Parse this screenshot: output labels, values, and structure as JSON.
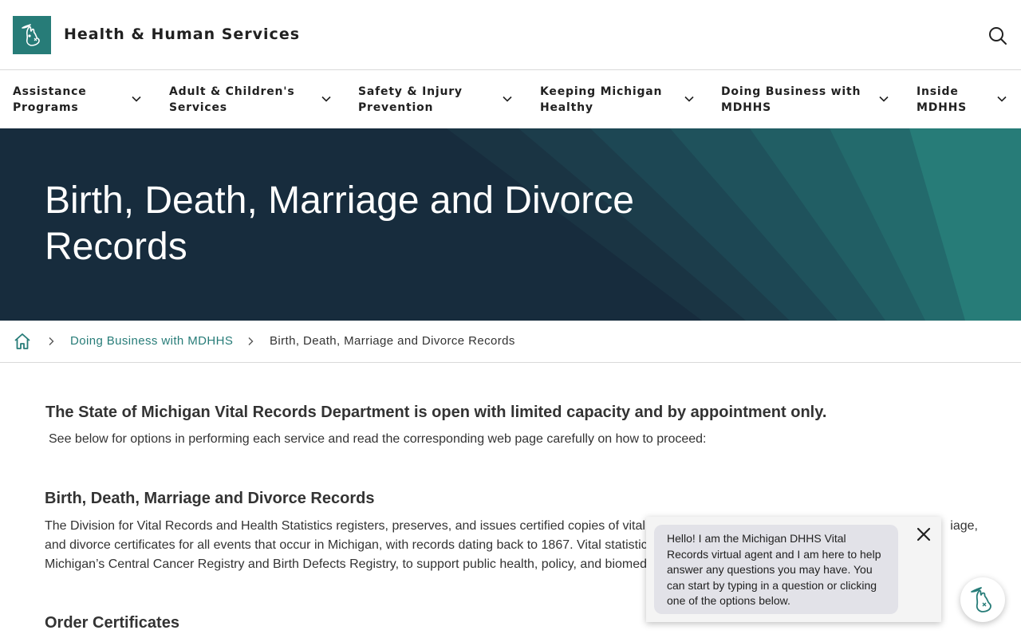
{
  "header": {
    "site_title": "Health & Human Services",
    "logo_icon": "michigan-mitten-icon",
    "search_icon": "search-icon"
  },
  "nav": {
    "items": [
      {
        "line1": "Assistance",
        "line2": "Programs"
      },
      {
        "line1": "Adult & Children's",
        "line2": "Services"
      },
      {
        "line1": "Safety & Injury",
        "line2": "Prevention"
      },
      {
        "line1": "Keeping Michigan",
        "line2": "Healthy"
      },
      {
        "line1": "Doing Business with",
        "line2": "MDHHS"
      },
      {
        "line1": "Inside",
        "line2": "MDHHS"
      }
    ]
  },
  "hero": {
    "title_line1": "Birth, Death, Marriage and Divorce",
    "title_line2": "Records"
  },
  "breadcrumb": {
    "home_icon": "home-icon",
    "link": "Doing Business with MDHHS",
    "current": "Birth, Death, Marriage and Divorce Records"
  },
  "content": {
    "notice_heading": "The State of Michigan Vital Records Department is open with limited capacity and by appointment only.",
    "notice_text": "See below for options in performing each service and read the corresponding web page carefully on how to proceed:",
    "section_heading": "Birth, Death, Marriage and Divorce Records",
    "section_line1": "The Division for Vital Records and Health Statistics registers, preserves, and issues certified copies of vital",
    "section_line1_end": "iage,",
    "section_line2": "and divorce certificates for all events that occur in Michigan, with records dating back to 1867. Vital statistic",
    "section_line3": "Michigan’s Central Cancer Registry and Birth Defects Registry, to support public health, policy, and biomed",
    "order_heading": "Order Certificates"
  },
  "chat": {
    "message": "Hello! I am the Michigan DHHS Vital Records virtual agent and I am here to help answer any questions you may have. You can start by typing in a question or clicking one of the options below.",
    "close_icon": "close-icon",
    "launcher_icon": "michigan-mitten-icon"
  },
  "colors": {
    "brand_teal": "#277c78",
    "hero_navy": "#172c3d"
  }
}
